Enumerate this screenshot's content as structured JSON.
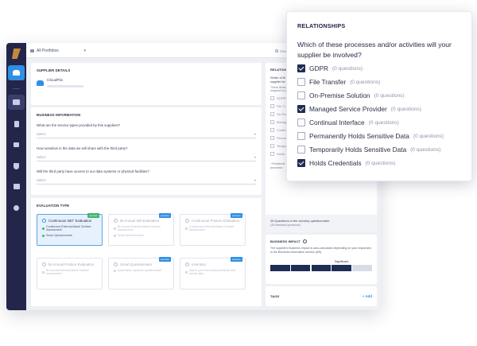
{
  "topbar": {
    "portfolio": "All Portfolios",
    "search_placeholder": "Search"
  },
  "supplier": {
    "section_title": "SUPPLIER DETAILS",
    "name": "CloudFlix"
  },
  "business_info": {
    "section_title": "BUSINESS INFORMATION",
    "questions": [
      {
        "label": "What are the service types provided by this suppliers?",
        "placeholder": "Select"
      },
      {
        "label": "How sensitive is the data we will share with the third party?",
        "placeholder": "Select"
      },
      {
        "label": "Will the third party have access to our data systems or physical facilities?",
        "placeholder": "Select"
      }
    ]
  },
  "evaluation": {
    "section_title": "EVALUATION TYPE",
    "cards": [
      {
        "title": "Continuous 360° Evaluation",
        "badge": "premium",
        "badge_color": "#3fb56b",
        "lines": [
          "Continuous External Attack Surface Assessment",
          "Smart Questionnaire"
        ]
      },
      {
        "title": "Bi-Annual 360 Evaluation",
        "badge": "premium",
        "badge_color": "#2f8fe4",
        "lines": [
          "Bi-Annual External Attack Surface Assessment",
          "Smart Questionnaire"
        ]
      },
      {
        "title": "Continuous Posture Evaluation",
        "badge": "premium",
        "badge_color": "#2f8fe4",
        "lines": [
          "Continuous External Attack Surface Assessment"
        ]
      },
      {
        "title": "Bi-Annual Posture Evaluation",
        "badge": "",
        "badge_color": "",
        "lines": [
          "Bi-Annual External Attack Surface Assessment"
        ]
      },
      {
        "title": "Smart Questionnaire",
        "badge": "premium",
        "badge_color": "#2f8fe4",
        "lines": [
          "Automated, dynamic questionnaire"
        ]
      },
      {
        "title": "Inventory",
        "badge": "premium",
        "badge_color": "#2f8fe4",
        "lines": [
          "Add to your third party inventory and decide later"
        ]
      }
    ]
  },
  "right_panel": {
    "section_title": "RELATIONSHIPS",
    "question_short": "Which of th supplier be",
    "note_short": "These items mapped to y",
    "mini_items": [
      "GDPR",
      "File Tr",
      "On-Pre",
      "Manag",
      "Contin",
      "Perma",
      "Tempo",
      "Holds"
    ],
    "footnote": "* Relations! * processin",
    "questions_summary": "28 Questions in the security questionnaire",
    "questions_sub": "(28 standard questions)",
    "impact_title": "BUSINESS IMPACT",
    "impact_text": "The supplier's Business Impact is auto-calculated depending on your responses in the Business Information section (left).",
    "impact_label": "Significant",
    "impact_level": 4,
    "impact_levels": 5,
    "tags_title": "TAGS",
    "tags_add": "+ Add"
  },
  "popup": {
    "title": "RELATIONSHIPS",
    "question": "Which of these processes and/or activities will your supplier be involved?",
    "options": [
      {
        "label": "GDPR",
        "count": "(0 questions)",
        "checked": true
      },
      {
        "label": "File Transfer",
        "count": "(0 questions)",
        "checked": false
      },
      {
        "label": "On-Premise Solution",
        "count": "(0 questions)",
        "checked": false
      },
      {
        "label": "Managed Service Provider",
        "count": "(0 questions)",
        "checked": true
      },
      {
        "label": "Continual Interface",
        "count": "(0 questions)",
        "checked": false
      },
      {
        "label": "Permanently Holds Sensitive Data",
        "count": "(0 questions)",
        "checked": false
      },
      {
        "label": "Temporarily Holds Sensitive Data",
        "count": "(0 questions)",
        "checked": false
      },
      {
        "label": "Holds Credentials",
        "count": "(0 questions)",
        "checked": true
      }
    ]
  },
  "colors": {
    "sidebar": "#23264a",
    "accent": "#2f8fe4",
    "checked": "#1f2d55",
    "impact": "#1f2d55"
  }
}
